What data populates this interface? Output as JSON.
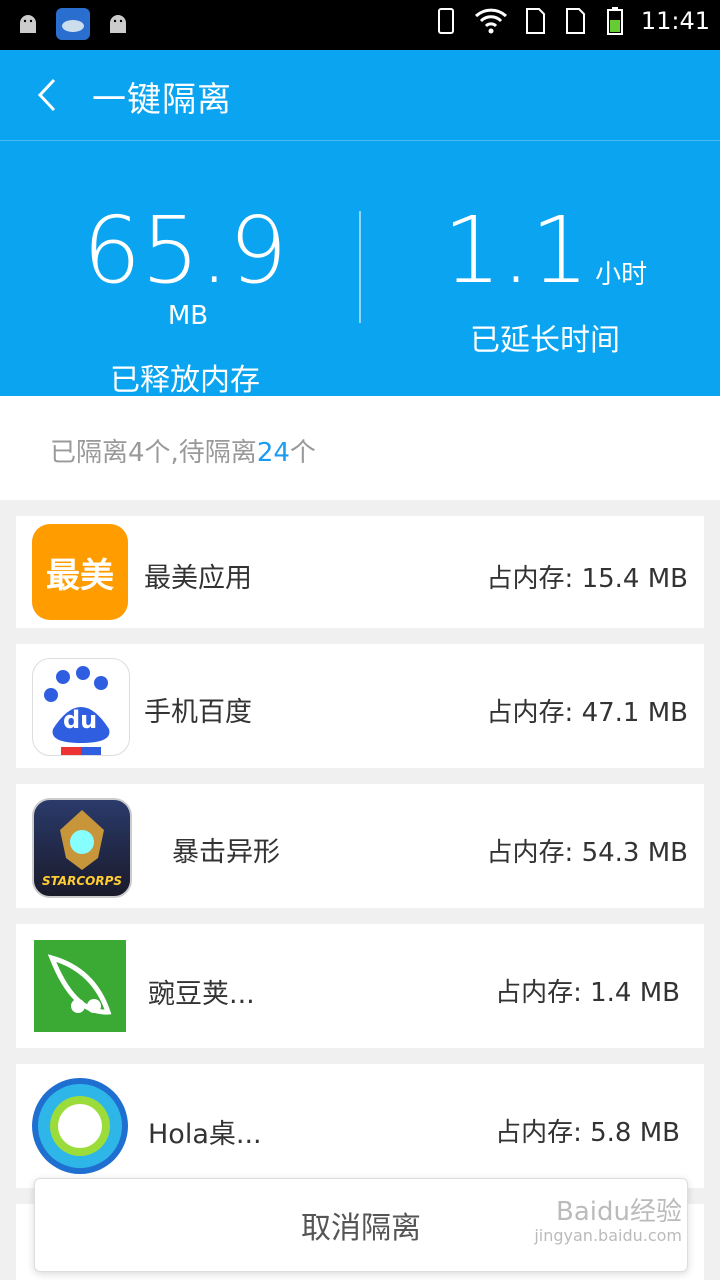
{
  "status_bar": {
    "time": "11:41"
  },
  "app_bar": {
    "title": "一键隔离"
  },
  "summary": {
    "memory_value": "65.9",
    "memory_unit": "MB",
    "memory_label": "已释放内存",
    "time_value": "1.1",
    "time_unit": "小时",
    "time_label": "已延长时间"
  },
  "counts": {
    "prefix": "已隔离4个,待隔离",
    "pending": "24",
    "suffix": "个"
  },
  "apps": [
    {
      "name": "最美应用",
      "icon_text": "最美",
      "memory": "占内存: 15.4 MB",
      "icon": "zuimei-icon"
    },
    {
      "name": "手机百度",
      "icon_text": "du",
      "memory": "占内存: 47.1 MB",
      "icon": "baidu-icon"
    },
    {
      "name": "暴击异形",
      "icon_text": "STARCORPS",
      "memory": "占内存: 54.3 MB",
      "icon": "game-icon"
    },
    {
      "name": "豌豆荚...",
      "memory": "占内存: 1.4 MB",
      "icon": "wandoujia-icon"
    },
    {
      "name": "Hola桌...",
      "memory": "占内存: 5.8 MB",
      "icon": "hola-icon"
    }
  ],
  "cancel_button": "取消隔离",
  "watermark": {
    "line1": "Baidu经验",
    "line2": "jingyan.baidu.com"
  },
  "colors": {
    "accent": "#0aa4f0",
    "count_highlight": "#1a9df0",
    "zuimei": "#ff9d00",
    "wandoujia": "#3aaa35"
  }
}
